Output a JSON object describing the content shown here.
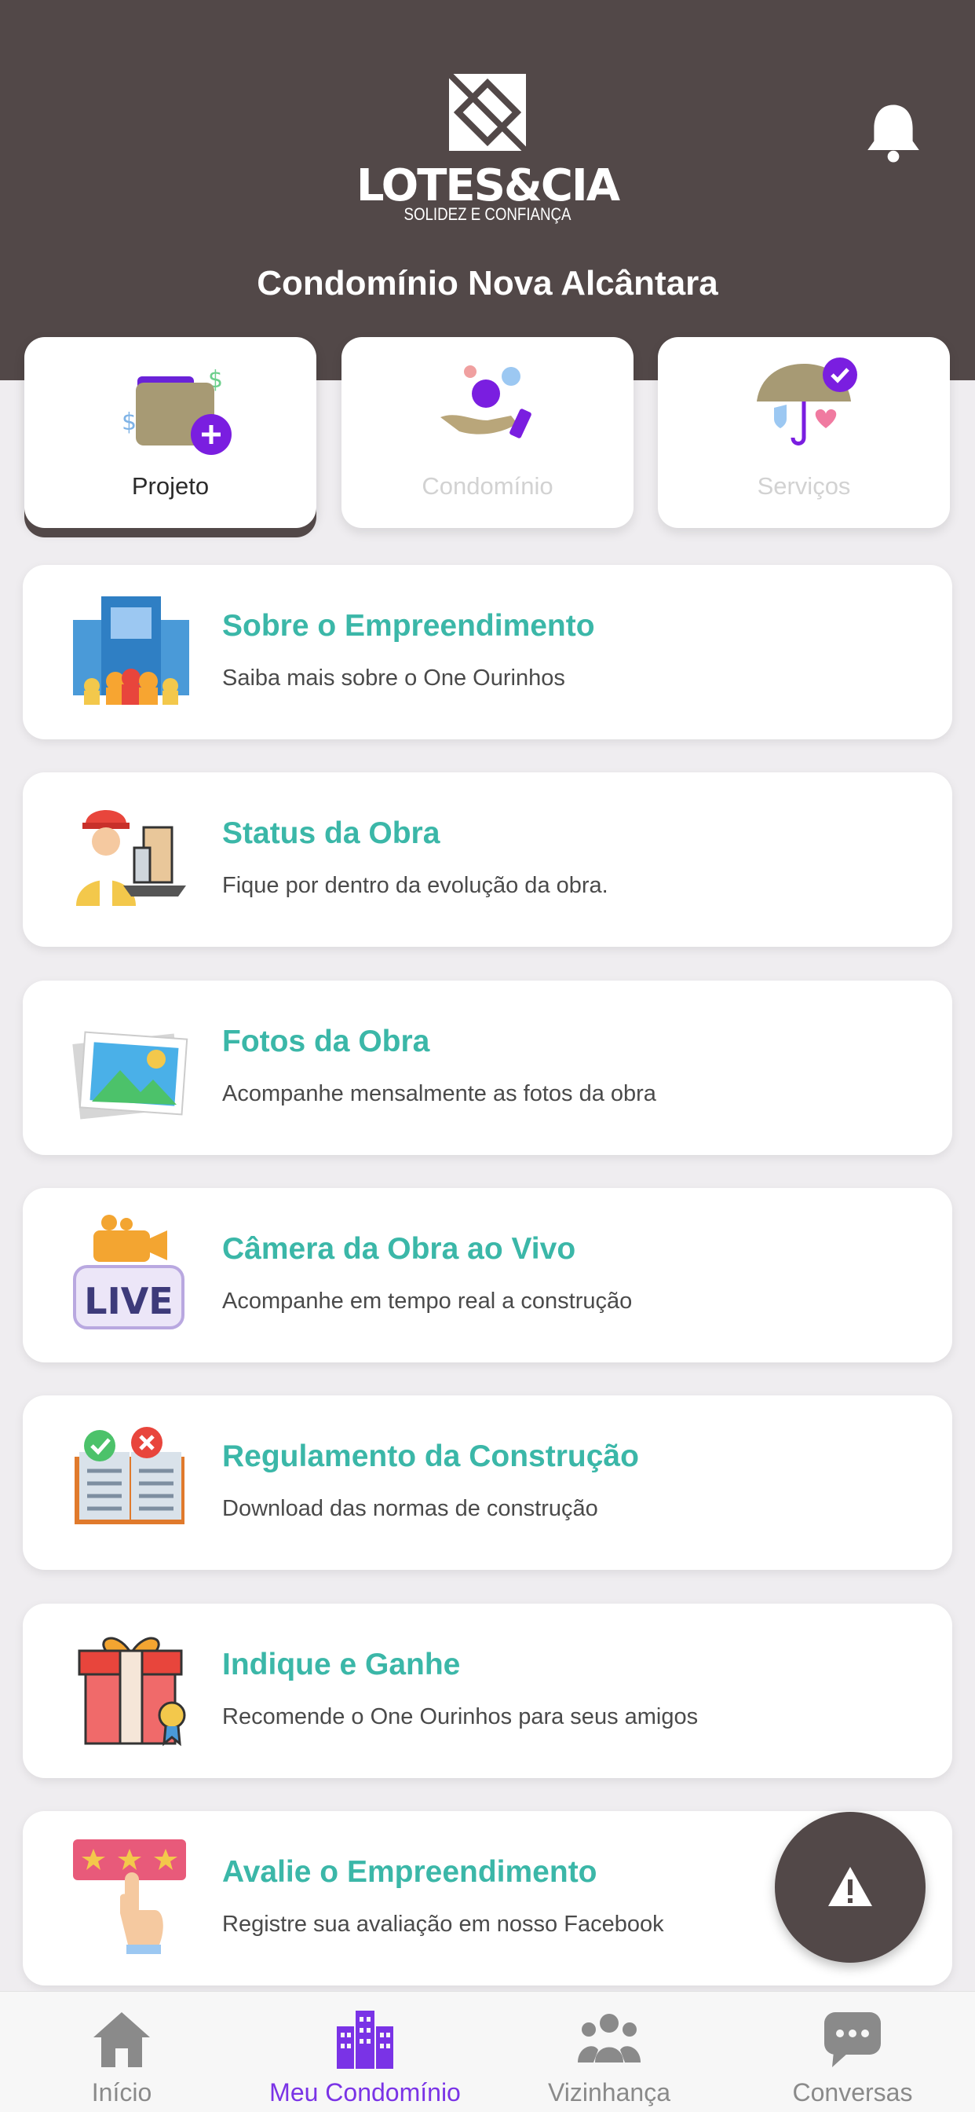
{
  "header": {
    "logo_name": "LOTES&CIA",
    "logo_tagline": "SOLIDEZ E CONFIANÇA",
    "condo_title": "Condomínio Nova Alcântara"
  },
  "tabs": [
    {
      "label": "Projeto",
      "icon": "wallet-plus-icon",
      "active": true
    },
    {
      "label": "Condomínio",
      "icon": "hand-coins-icon",
      "active": false
    },
    {
      "label": "Serviços",
      "icon": "umbrella-shield-icon",
      "active": false
    }
  ],
  "menu": [
    {
      "title": "Sobre o Empreendimento",
      "subtitle": "Saiba mais sobre o One Ourinhos",
      "icon": "building-people-icon"
    },
    {
      "title": "Status da Obra",
      "subtitle": "Fique por dentro da evolução da obra.",
      "icon": "construction-worker-icon"
    },
    {
      "title": "Fotos da Obra",
      "subtitle": "Acompanhe mensalmente as fotos da obra",
      "icon": "photos-icon"
    },
    {
      "title": "Câmera da Obra ao Vivo",
      "subtitle": "Acompanhe em tempo real a construção",
      "icon": "live-camera-icon"
    },
    {
      "title": "Regulamento da Construção",
      "subtitle": "Download das normas de construção",
      "icon": "rulebook-icon"
    },
    {
      "title": "Indique e Ganhe",
      "subtitle": "Recomende o One Ourinhos para seus amigos",
      "icon": "gift-icon"
    },
    {
      "title": "Avalie o Empreendimento",
      "subtitle": "Registre sua avaliação em nosso Facebook",
      "icon": "rating-stars-icon"
    }
  ],
  "fab": {
    "icon": "warning-icon"
  },
  "bottom_nav": [
    {
      "label": "Início",
      "icon": "home-icon",
      "active": false
    },
    {
      "label": "Meu Condomínio",
      "icon": "buildings-icon",
      "active": true
    },
    {
      "label": "Vizinhança",
      "icon": "people-group-icon",
      "active": false
    },
    {
      "label": "Conversas",
      "icon": "chat-bubble-icon",
      "active": false
    }
  ],
  "colors": {
    "header_bg": "#524848",
    "accent_teal": "#3bb7a8",
    "accent_purple": "#7a33e6",
    "background": "#efedf0"
  }
}
